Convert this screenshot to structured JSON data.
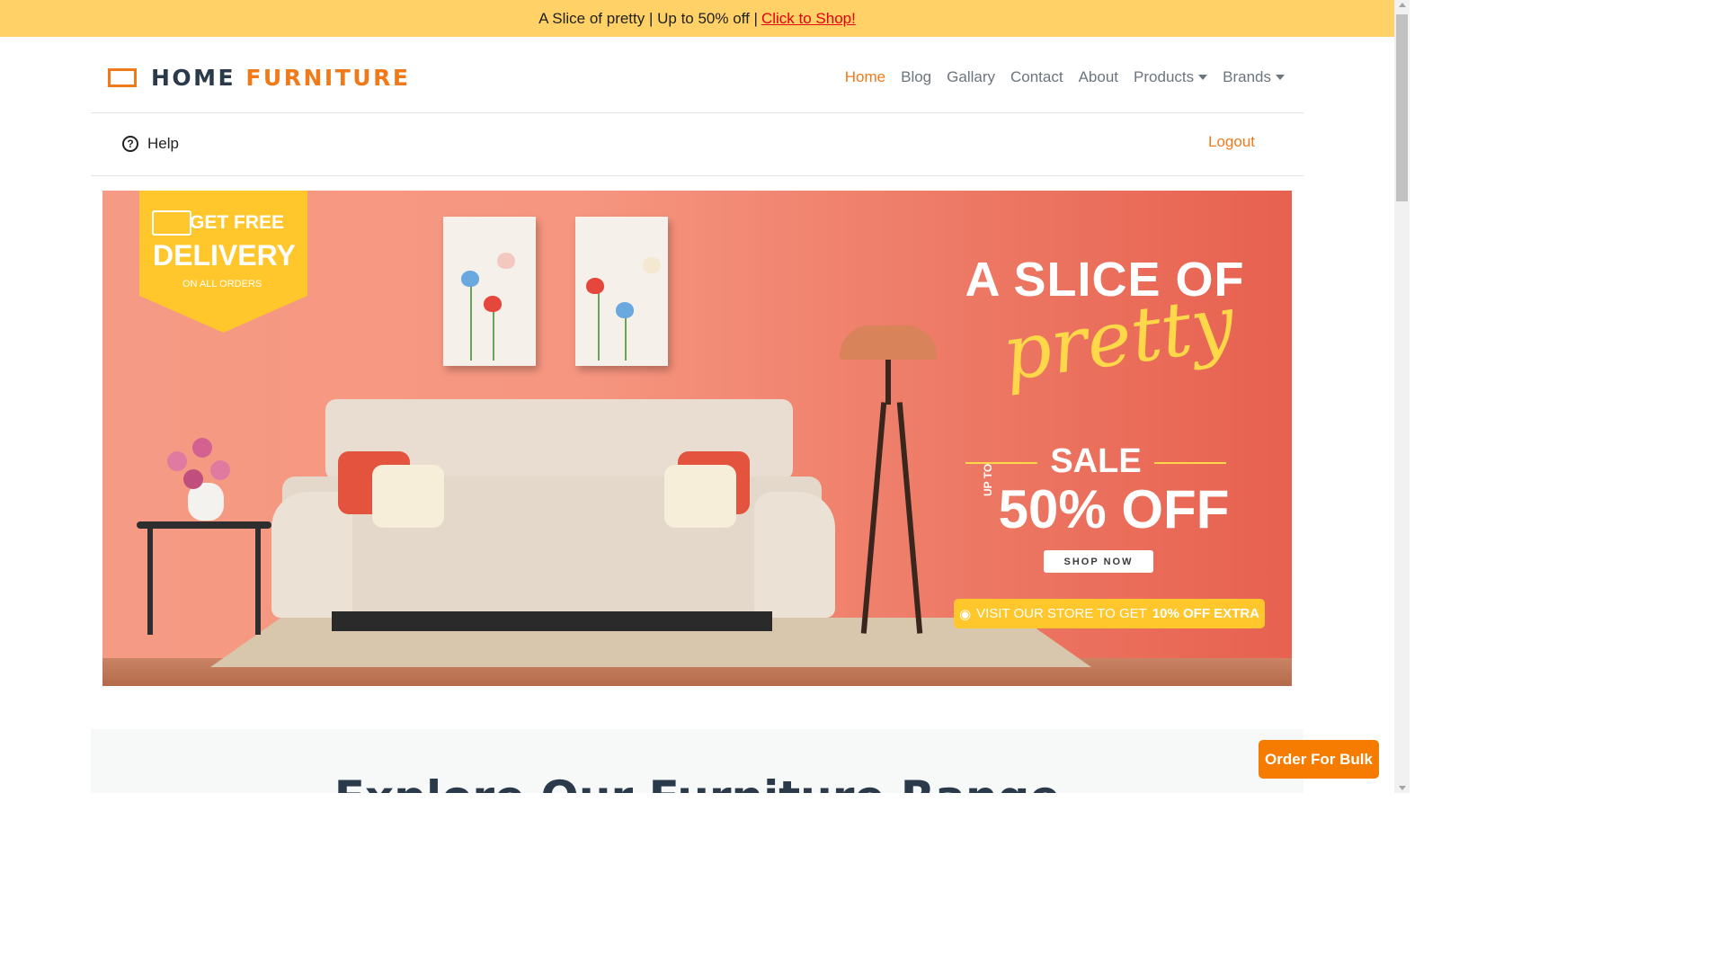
{
  "announcement": {
    "text": "A Slice of pretty | Up to 50% off |",
    "link_label": "Click to Shop!"
  },
  "brand": {
    "word1": "HOME",
    "word2": "FURNITURE"
  },
  "nav": {
    "items": [
      "Home",
      "Blog",
      "Gallary",
      "Contact",
      "About",
      "Products",
      "Brands"
    ],
    "active": "Home"
  },
  "subnav": {
    "help_label": "Help",
    "help_icon": "question-circle-icon",
    "logout_label": "Logout"
  },
  "banner": {
    "ribbon": {
      "line1": "GET FREE",
      "line2": "DELIVERY",
      "line3": "ON ALL ORDERS",
      "icon": "truck-icon"
    },
    "headline1": "A SLICE OF",
    "headline2": "pretty",
    "sale": "SALE",
    "upto": "UP TO",
    "discount": "50% OFF",
    "shop_now": "SHOP NOW",
    "visit_text": "VISIT OUR STORE TO GET",
    "visit_bold": "10% OFF EXTRA",
    "visit_icon": "location-pin-icon"
  },
  "section": {
    "title": "Explore Our Furniture Range"
  },
  "floating": {
    "bulk_label": "Order For Bulk"
  },
  "colors": {
    "announcement_bg": "#ffd166",
    "accent": "#f07a1a",
    "bulk_button": "#f57c00",
    "link_red": "#e3000f"
  }
}
